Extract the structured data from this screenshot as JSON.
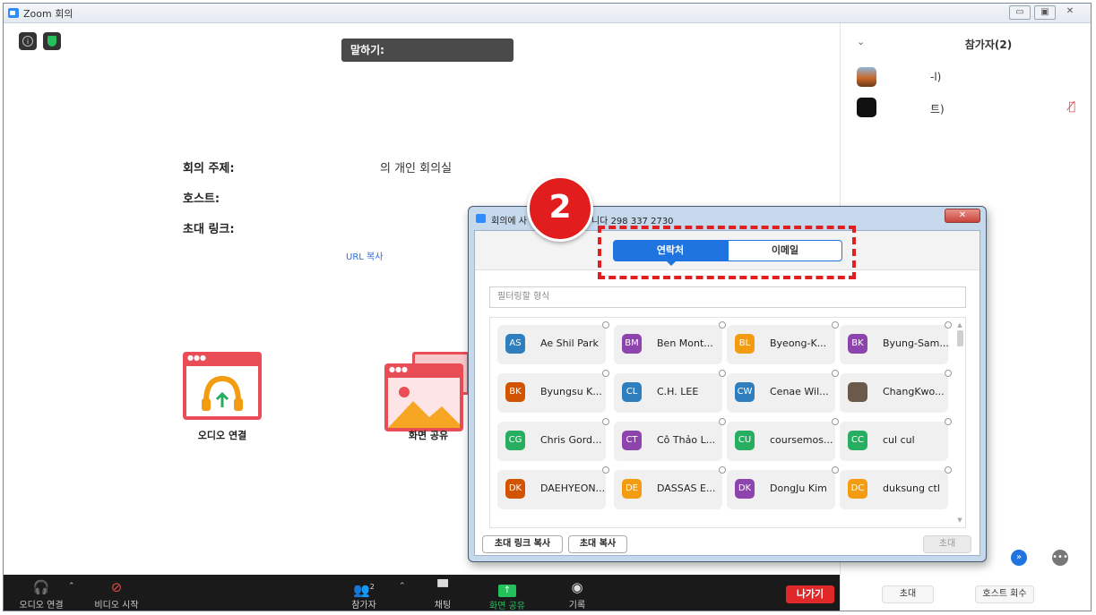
{
  "window": {
    "title": "Zoom 회의"
  },
  "meeting": {
    "speaking_label": "말하기:",
    "info": {
      "topic_label": "회의 주제:",
      "topic_value": "의 개인 회의실",
      "host_label": "호스트:",
      "invite_link_label": "초대 링크:",
      "url_copy": "URL 복사"
    },
    "tiles": {
      "audio": "오디오 연결",
      "share": "화면 공유"
    }
  },
  "participants": {
    "title": "참가자(2)",
    "items": [
      {
        "name": "-l)"
      },
      {
        "name": "트)",
        "muted": true
      }
    ],
    "footer": {
      "invite": "초대",
      "reclaim_host": "호스트 회수"
    }
  },
  "toolbar": {
    "audio": "오디오 연결",
    "video": "비디오 시작",
    "participants": "참가자",
    "participants_count": "2",
    "chat": "채팅",
    "share": "화면 공유",
    "record": "기록",
    "leave": "나가기"
  },
  "dialog": {
    "title": "회의에 사",
    "title_suffix": "니다 298 337 2730",
    "tabs": {
      "contacts": "연락처",
      "email": "이메일"
    },
    "filter_placeholder": "필터링할 형식",
    "contacts": [
      {
        "initials": "AS",
        "name": "Ae Shil Park",
        "color": "#2f7fbf"
      },
      {
        "initials": "BM",
        "name": "Ben Mont...",
        "color": "#8e44ad"
      },
      {
        "initials": "BL",
        "name": "Byeong-K...",
        "color": "#f39c12"
      },
      {
        "initials": "BK",
        "name": "Byung-Sam...",
        "color": "#8e44ad"
      },
      {
        "initials": "BK",
        "name": "Byungsu K...",
        "color": "#d35400"
      },
      {
        "initials": "CL",
        "name": "C.H. LEE",
        "color": "#2f7fbf"
      },
      {
        "initials": "CW",
        "name": "Cenae Wil...",
        "color": "#2f7fbf"
      },
      {
        "initials": "",
        "name": "ChangKwo...",
        "color": "#6b5a4a"
      },
      {
        "initials": "CG",
        "name": "Chris Gord...",
        "color": "#27ae60"
      },
      {
        "initials": "CT",
        "name": "Cô Thảo L...",
        "color": "#8e44ad"
      },
      {
        "initials": "CU",
        "name": "coursemos...",
        "color": "#27ae60"
      },
      {
        "initials": "CC",
        "name": "cul cul",
        "color": "#27ae60"
      },
      {
        "initials": "DK",
        "name": "DAEHYEON...",
        "color": "#d35400"
      },
      {
        "initials": "DE",
        "name": "DASSAS E...",
        "color": "#f39c12"
      },
      {
        "initials": "DK",
        "name": "DongJu Kim",
        "color": "#8e44ad"
      },
      {
        "initials": "DC",
        "name": "duksung ctl",
        "color": "#f39c12"
      }
    ],
    "buttons": {
      "copy_link": "초대 링크 복사",
      "copy_invite": "초대 복사",
      "invite": "초대"
    }
  },
  "step_badge": "2"
}
